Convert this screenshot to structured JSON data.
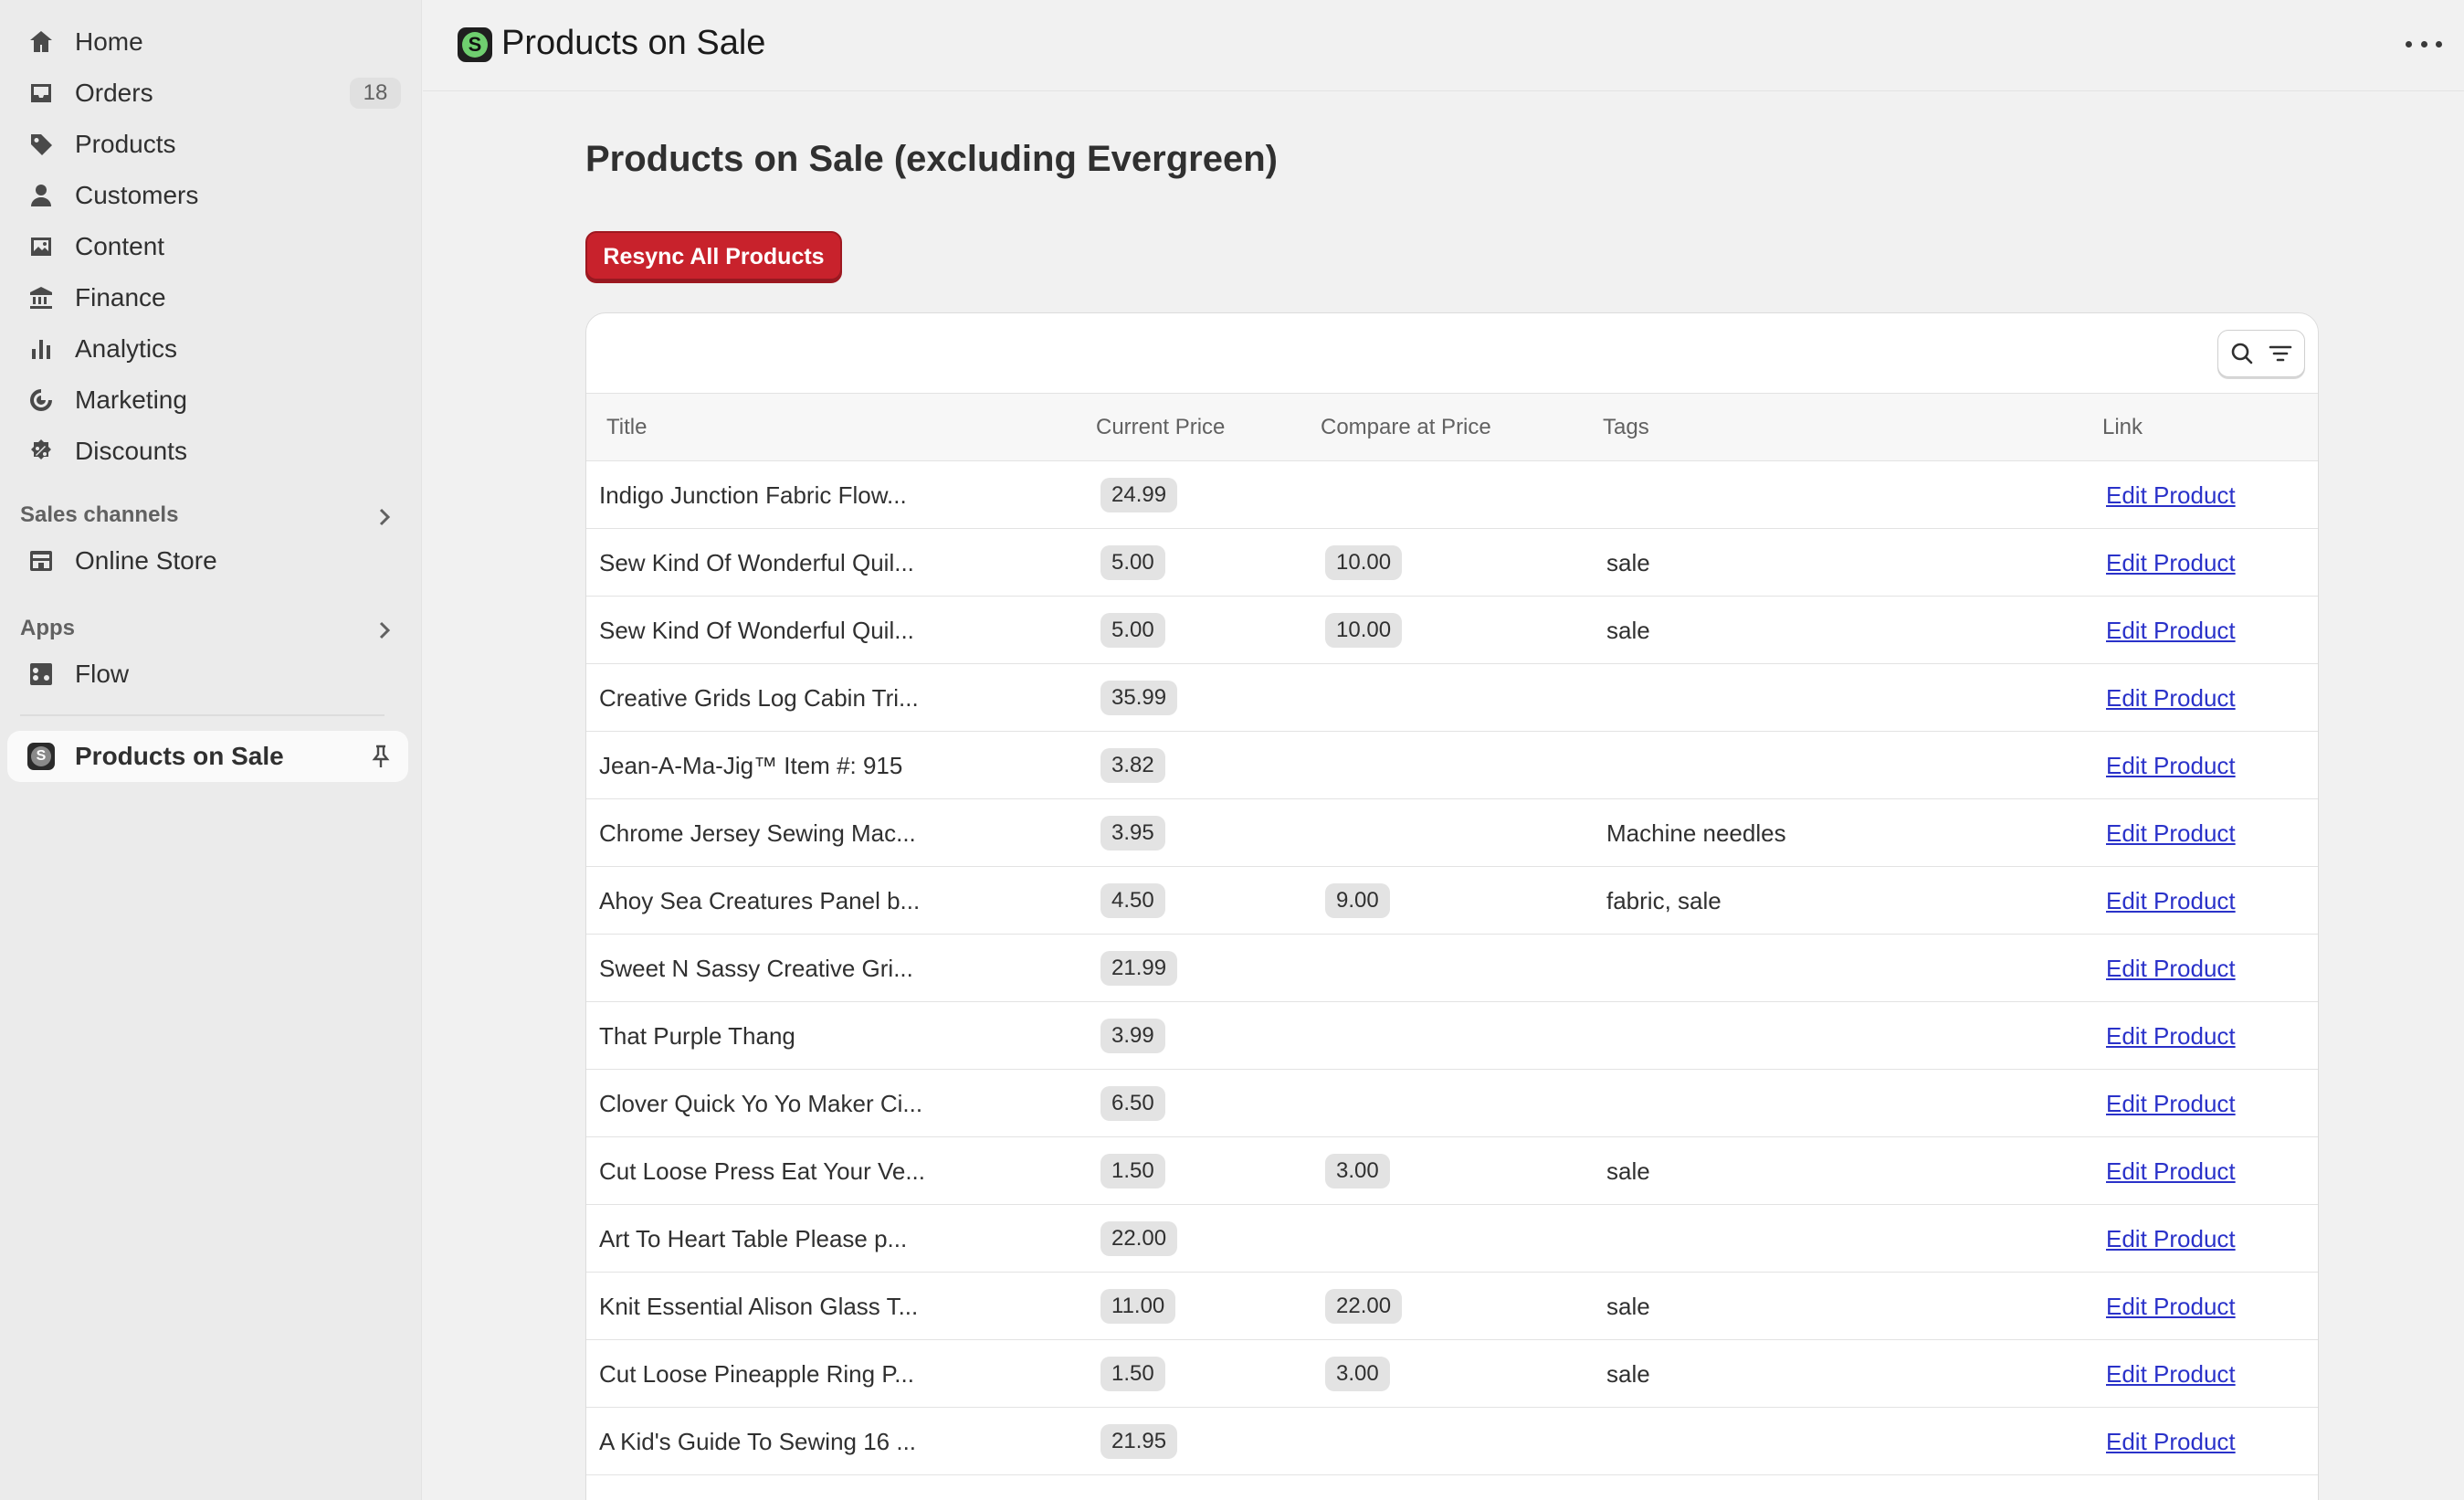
{
  "sidebar": {
    "nav": [
      {
        "label": "Home",
        "icon": "home-icon"
      },
      {
        "label": "Orders",
        "icon": "inbox-icon",
        "badge": "18"
      },
      {
        "label": "Products",
        "icon": "tag-icon"
      },
      {
        "label": "Customers",
        "icon": "person-icon"
      },
      {
        "label": "Content",
        "icon": "image-icon"
      },
      {
        "label": "Finance",
        "icon": "bank-icon"
      },
      {
        "label": "Analytics",
        "icon": "bar-chart-icon"
      },
      {
        "label": "Marketing",
        "icon": "target-icon"
      },
      {
        "label": "Discounts",
        "icon": "discount-icon"
      }
    ],
    "sales_channels": {
      "label": "Sales channels",
      "items": [
        {
          "label": "Online Store",
          "icon": "store-icon"
        }
      ]
    },
    "apps": {
      "label": "Apps",
      "items": [
        {
          "label": "Flow",
          "icon": "flow-icon"
        }
      ]
    },
    "pinned": {
      "label": "Products on Sale",
      "icon": "app-s-icon"
    }
  },
  "header": {
    "title": "Products on Sale",
    "app_letter": "S"
  },
  "main": {
    "heading": "Products on Sale (excluding Evergreen)",
    "resync_label": "Resync All Products",
    "columns": [
      "Title",
      "Current Price",
      "Compare at Price",
      "Tags",
      "Link"
    ],
    "rows": [
      {
        "title": "Indigo Junction Fabric Flow...",
        "price": "24.99",
        "compare": "",
        "tags": "",
        "link": "Edit Product"
      },
      {
        "title": "Sew Kind Of Wonderful Quil...",
        "price": "5.00",
        "compare": "10.00",
        "tags": "sale",
        "link": "Edit Product"
      },
      {
        "title": "Sew Kind Of Wonderful Quil...",
        "price": "5.00",
        "compare": "10.00",
        "tags": "sale",
        "link": "Edit Product"
      },
      {
        "title": "Creative Grids Log Cabin Tri...",
        "price": "35.99",
        "compare": "",
        "tags": "",
        "link": "Edit Product"
      },
      {
        "title": "Jean-A-Ma-Jig™ Item #: 915",
        "price": "3.82",
        "compare": "",
        "tags": "",
        "link": "Edit Product"
      },
      {
        "title": "Chrome Jersey Sewing Mac...",
        "price": "3.95",
        "compare": "",
        "tags": "Machine needles",
        "link": "Edit Product"
      },
      {
        "title": "Ahoy Sea Creatures Panel b...",
        "price": "4.50",
        "compare": "9.00",
        "tags": "fabric, sale",
        "link": "Edit Product"
      },
      {
        "title": "Sweet N Sassy Creative Gri...",
        "price": "21.99",
        "compare": "",
        "tags": "",
        "link": "Edit Product"
      },
      {
        "title": "That Purple Thang",
        "price": "3.99",
        "compare": "",
        "tags": "",
        "link": "Edit Product"
      },
      {
        "title": "Clover Quick Yo Yo Maker Ci...",
        "price": "6.50",
        "compare": "",
        "tags": "",
        "link": "Edit Product"
      },
      {
        "title": "Cut Loose Press Eat Your Ve...",
        "price": "1.50",
        "compare": "3.00",
        "tags": "sale",
        "link": "Edit Product"
      },
      {
        "title": "Art To Heart Table Please p...",
        "price": "22.00",
        "compare": "",
        "tags": "",
        "link": "Edit Product"
      },
      {
        "title": "Knit Essential Alison Glass T...",
        "price": "11.00",
        "compare": "22.00",
        "tags": "sale",
        "link": "Edit Product"
      },
      {
        "title": "Cut Loose Pineapple Ring P...",
        "price": "1.50",
        "compare": "3.00",
        "tags": "sale",
        "link": "Edit Product"
      },
      {
        "title": "A Kid's Guide To Sewing 16 ...",
        "price": "21.95",
        "compare": "",
        "tags": "",
        "link": "Edit Product"
      }
    ]
  },
  "colors": {
    "accent_button": "#c8222c",
    "link": "#2a32c9",
    "app_icon_green": "#6fcf6f"
  }
}
